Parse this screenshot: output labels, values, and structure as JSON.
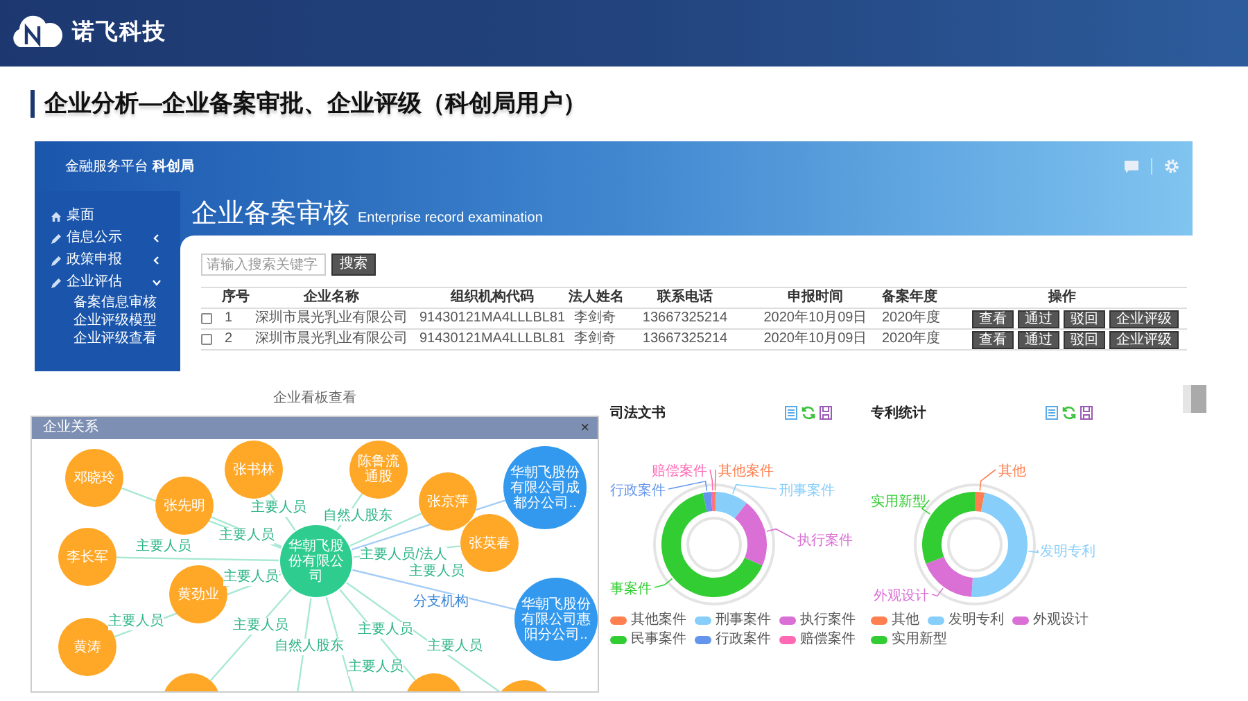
{
  "header": {
    "brand": "诺飞科技"
  },
  "title": "企业分析—企业备案审批、企业评级（科创局用户）",
  "app": {
    "platform": "金融服务平台 **科创局**",
    "page_title": "企业备案审核",
    "page_subtitle": "Enterprise record examination",
    "sidebar": [
      {
        "kind": "link",
        "label": "桌面"
      },
      {
        "kind": "menu",
        "label": "信息公示",
        "expanded": false
      },
      {
        "kind": "menu",
        "label": "政策申报",
        "expanded": false
      },
      {
        "kind": "menu",
        "label": "企业评估",
        "expanded": true,
        "children": [
          {
            "label": "备案信息审核"
          },
          {
            "label": "企业评级模型"
          },
          {
            "label": "企业评级查看"
          }
        ]
      }
    ],
    "search": {
      "placeholder": "请输入搜索关键字",
      "button": "搜索"
    },
    "table": {
      "columns": [
        "序号",
        "企业名称",
        "组织机构代码",
        "法人姓名",
        "联系电话",
        "申报时间",
        "备案年度",
        "操作"
      ],
      "rows": [
        {
          "checked": false,
          "cells": [
            "1",
            "深圳市晨光乳业有限公司",
            "91430121MA4LLLBL81",
            "李剑奇",
            "13667325214",
            "2020年10月09日",
            "2020年度"
          ],
          "actions": [
            "查看",
            "通过",
            "驳回",
            "企业评级"
          ]
        },
        {
          "checked": false,
          "cells": [
            "2",
            "深圳市晨光乳业有限公司",
            "91430121MA4LLLBL81",
            "李剑奇",
            "13667325214",
            "2020年10月09日",
            "2020年度"
          ],
          "actions": [
            "查看",
            "通过",
            "驳回",
            "企业评级"
          ]
        }
      ]
    }
  },
  "board": {
    "caption": "企业看板查看",
    "dialog": {
      "title": "企业关系",
      "close": "×",
      "nodes": [
        {
          "kind": "person",
          "name": "邓晓玲"
        },
        {
          "kind": "person",
          "name": "张书林",
          "edge_label": "主要人员"
        },
        {
          "kind": "person",
          "name": "陈鲁流通股",
          "edge_label": "自然人股东"
        },
        {
          "kind": "person",
          "name": "张先明",
          "edge_label": "主要人员"
        },
        {
          "kind": "person",
          "name": "张京萍",
          "edge_label": "主要人员/法人"
        },
        {
          "kind": "company",
          "name": "华朝飞股份有限公司成都分公司.."
        },
        {
          "kind": "person",
          "name": "李长军",
          "edge_label": "主要人员"
        },
        {
          "kind": "center",
          "name": "华朝飞股份有限公司"
        },
        {
          "kind": "person",
          "name": "张英春",
          "edge_label": "主要人员"
        },
        {
          "kind": "person",
          "name": "黄劲业",
          "edge_label": "主要人员"
        },
        {
          "kind": "person",
          "name": "黄涛",
          "edge_label": "主要人员"
        },
        {
          "kind": "company",
          "name": "华朝飞股份有限公司惠阳分公司..",
          "edge_label": "分支机构"
        },
        {
          "kind": "person",
          "edge_label": "主要人员"
        },
        {
          "kind": "person",
          "edge_label": "主要人员"
        },
        {
          "kind": "person",
          "edge_label": "自然人股东"
        },
        {
          "kind": "person",
          "edge_label": "主要人员"
        },
        {
          "kind": "person",
          "edge_label": "主要人员"
        }
      ]
    }
  },
  "charts": [
    {
      "title": "司法文书",
      "items": [
        {
          "legend": "其他案件",
          "label": "其他案件",
          "color": "#ff7f50"
        },
        {
          "legend": "刑事案件",
          "label": "刑事案件",
          "color": "#87cefa"
        },
        {
          "legend": "执行案件",
          "label": "执行案件",
          "color": "#da70d6"
        },
        {
          "legend": "民事案件",
          "label": "事案件",
          "color": "#32cd32"
        },
        {
          "legend": "行政案件",
          "label": "行政案件",
          "color": "#6495ed"
        },
        {
          "legend": "赔偿案件",
          "label": "赔偿案件",
          "color": "#ff69b4"
        }
      ]
    },
    {
      "title": "专利统计",
      "items": [
        {
          "legend": "其他",
          "label": "其他",
          "color": "#ff7f50"
        },
        {
          "legend": "发明专利",
          "label": "发明专利",
          "color": "#87cefa"
        },
        {
          "legend": "外观设计",
          "label": "外观设计",
          "color": "#da70d6"
        },
        {
          "legend": "实用新型",
          "label": "实用新型",
          "color": "#32cd32"
        }
      ]
    }
  ]
}
